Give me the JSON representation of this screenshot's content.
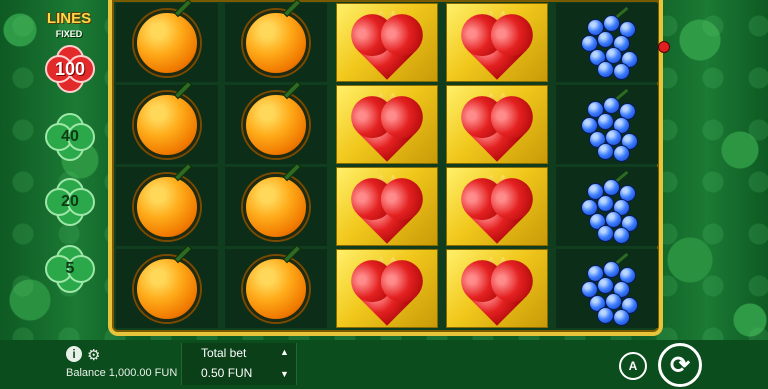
{
  "lines_panel": {
    "title": "LINES",
    "subtitle": "FIXED",
    "options": [
      "100",
      "40",
      "20",
      "5"
    ],
    "selected": "100"
  },
  "reels": {
    "columns": [
      [
        "orange",
        "orange",
        "orange",
        "orange"
      ],
      [
        "orange",
        "orange",
        "orange",
        "orange"
      ],
      [
        "crowned-heart",
        "crowned-heart",
        "crowned-heart",
        "crowned-heart"
      ],
      [
        "crowned-heart",
        "crowned-heart",
        "crowned-heart",
        "crowned-heart"
      ],
      [
        "grapes",
        "grapes",
        "grapes",
        "grapes"
      ]
    ]
  },
  "footer": {
    "balance_text": "Balance 1,000.00 FUN",
    "total_bet_label": "Total bet",
    "total_bet_value": "0.50 FUN",
    "auto_label": "A",
    "info_icon": "info-icon",
    "settings_icon": "gear-icon",
    "spin_icon": "refresh-arrows-icon"
  },
  "colors": {
    "frame_gold": "#e7c43a",
    "selected_line_red": "#e32a2a",
    "line_green": "#2aa84a"
  }
}
